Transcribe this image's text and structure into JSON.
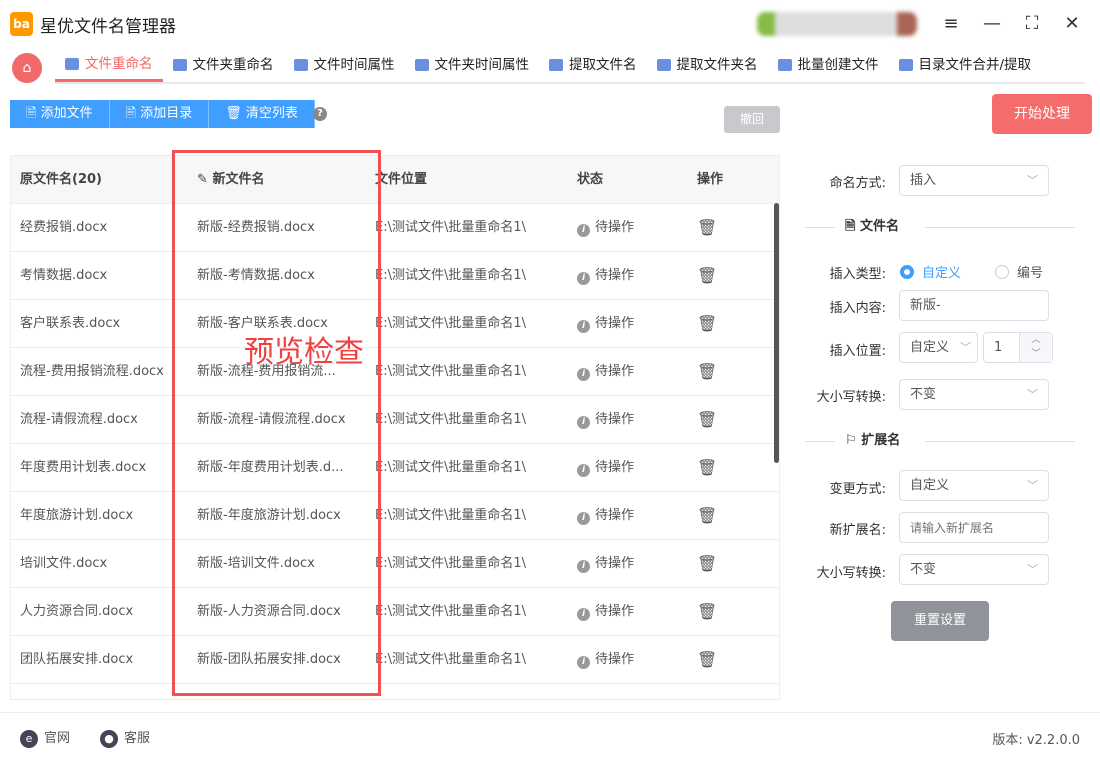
{
  "app": {
    "title": "星优文件名管理器",
    "logo_text": "ba"
  },
  "window": {
    "settings_icon": "sliders-icon",
    "minimize": "—",
    "maximize": "⛶",
    "close": "✕"
  },
  "tabs": [
    {
      "label": "文件重命名",
      "active": true
    },
    {
      "label": "文件夹重命名"
    },
    {
      "label": "文件时间属性"
    },
    {
      "label": "文件夹时间属性"
    },
    {
      "label": "提取文件名"
    },
    {
      "label": "提取文件夹名"
    },
    {
      "label": "批量创建文件"
    },
    {
      "label": "目录文件合并/提取"
    }
  ],
  "toolbar": {
    "add_file": "添加文件",
    "add_dir": "添加目录",
    "clear": "清空列表",
    "help": "?",
    "undo": "撤回",
    "start": "开始处理"
  },
  "table": {
    "headers": [
      "原文件名(20)",
      "新文件名",
      "文件位置",
      "状态",
      "操作"
    ],
    "rows": [
      [
        "经费报销.docx",
        "新版-经费报销.docx",
        "E:\\测试文件\\批量重命名1\\",
        "待操作"
      ],
      [
        "考情数据.docx",
        "新版-考情数据.docx",
        "E:\\测试文件\\批量重命名1\\",
        "待操作"
      ],
      [
        "客户联系表.docx",
        "新版-客户联系表.docx",
        "E:\\测试文件\\批量重命名1\\",
        "待操作"
      ],
      [
        "流程-费用报销流程.docx",
        "新版-流程-费用报销流...",
        "E:\\测试文件\\批量重命名1\\",
        "待操作"
      ],
      [
        "流程-请假流程.docx",
        "新版-流程-请假流程.docx",
        "E:\\测试文件\\批量重命名1\\",
        "待操作"
      ],
      [
        "年度费用计划表.docx",
        "新版-年度费用计划表.d...",
        "E:\\测试文件\\批量重命名1\\",
        "待操作"
      ],
      [
        "年度旅游计划.docx",
        "新版-年度旅游计划.docx",
        "E:\\测试文件\\批量重命名1\\",
        "待操作"
      ],
      [
        "培训文件.docx",
        "新版-培训文件.docx",
        "E:\\测试文件\\批量重命名1\\",
        "待操作"
      ],
      [
        "人力资源合同.docx",
        "新版-人力资源合同.docx",
        "E:\\测试文件\\批量重命名1\\",
        "待操作"
      ],
      [
        "团队拓展安排.docx",
        "新版-团队拓展安排.docx",
        "E:\\测试文件\\批量重命名1\\",
        "待操作"
      ]
    ]
  },
  "annotation": {
    "label": "预览检查",
    "color": "#f04040"
  },
  "panel": {
    "naming_label": "命名方式:",
    "naming_value": "插入",
    "filename_section": "文件名",
    "insert_type_label": "插入类型:",
    "insert_type_options": [
      "自定义",
      "编号"
    ],
    "insert_type_selected": "自定义",
    "insert_content_label": "插入内容:",
    "insert_content_value": "新版-",
    "insert_pos_label": "插入位置:",
    "insert_pos_mode": "自定义",
    "insert_pos_value": "1",
    "case_label": "大小写转换:",
    "case_value": "不变",
    "ext_section": "扩展名",
    "change_label": "变更方式:",
    "change_value": "自定义",
    "new_ext_label": "新扩展名:",
    "new_ext_placeholder": "请输入新扩展名",
    "ext_case_label": "大小写转换:",
    "ext_case_value": "不变",
    "reset": "重置设置"
  },
  "footer": {
    "website": "官网",
    "support": "客服",
    "version": "版本: v2.2.0.0"
  },
  "colors": {
    "accent": "#f06a6a",
    "primary": "#409eff"
  }
}
